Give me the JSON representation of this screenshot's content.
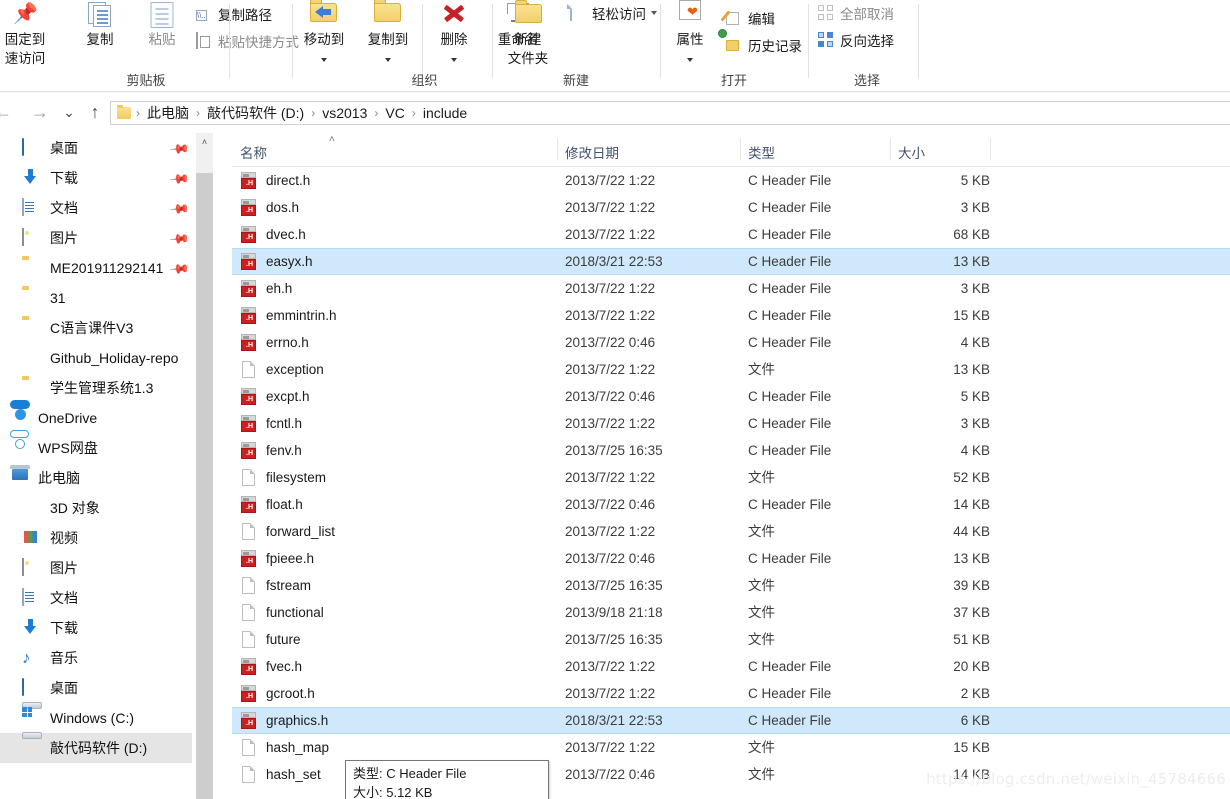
{
  "ribbon": {
    "groups": [
      {
        "name": "clipboard",
        "label": "剪贴板"
      },
      {
        "name": "organize",
        "label": "组织"
      },
      {
        "name": "new",
        "label": "新建"
      },
      {
        "name": "open",
        "label": "打开"
      },
      {
        "name": "select",
        "label": "选择"
      }
    ],
    "pin_to_quick_access": {
      "line1": "固定到",
      "line2": "速访问"
    },
    "copy": "复制",
    "paste": "粘贴",
    "copy_path": "复制路径",
    "paste_shortcut": "粘贴快捷方式",
    "move_to": "移动到",
    "copy_to": "复制到",
    "delete": "删除",
    "rename": "重命名",
    "new_folder": {
      "line1": "新建",
      "line2": "文件夹"
    },
    "easy_access": "轻松访问",
    "properties": "属性",
    "edit": "编辑",
    "history": "历史记录",
    "select_none": "全部取消",
    "invert_selection": "反向选择"
  },
  "nav": {
    "back_icon": "←",
    "forward_icon": "→",
    "recent_icon": "⌄",
    "up_icon": "↑",
    "breadcrumbs": [
      "此电脑",
      "敲代码软件 (D:)",
      "vs2013",
      "VC",
      "include"
    ],
    "separator": "›"
  },
  "sidebar": {
    "items": [
      {
        "label": "桌面",
        "icon": "desktop-icon",
        "indent": 1,
        "pinned": true
      },
      {
        "label": "下载",
        "icon": "download-icon",
        "indent": 1,
        "pinned": true
      },
      {
        "label": "文档",
        "icon": "documents-icon",
        "indent": 1,
        "pinned": true
      },
      {
        "label": "图片",
        "icon": "pictures-icon",
        "indent": 1,
        "pinned": true
      },
      {
        "label": "ME201911292141",
        "icon": "folder-icon",
        "indent": 1,
        "pinned": true
      },
      {
        "label": "31",
        "icon": "folder-icon",
        "indent": 1,
        "pinned": false
      },
      {
        "label": "C语言课件V3",
        "icon": "folder-icon",
        "indent": 1,
        "pinned": false
      },
      {
        "label": "Github_Holiday-repo",
        "icon": "git-folder-icon",
        "indent": 1,
        "pinned": false
      },
      {
        "label": "学生管理系统1.3",
        "icon": "folder-icon",
        "indent": 1,
        "pinned": false
      },
      {
        "label": "OneDrive",
        "icon": "onedrive-icon",
        "indent": 0,
        "pinned": false
      },
      {
        "label": "WPS网盘",
        "icon": "wps-cloud-icon",
        "indent": 0,
        "pinned": false
      },
      {
        "label": "此电脑",
        "icon": "this-pc-icon",
        "indent": 0,
        "pinned": false
      },
      {
        "label": "3D 对象",
        "icon": "3d-objects-icon",
        "indent": 1,
        "pinned": false
      },
      {
        "label": "视频",
        "icon": "videos-icon",
        "indent": 1,
        "pinned": false
      },
      {
        "label": "图片",
        "icon": "pictures-icon",
        "indent": 1,
        "pinned": false
      },
      {
        "label": "文档",
        "icon": "documents-icon",
        "indent": 1,
        "pinned": false
      },
      {
        "label": "下载",
        "icon": "download-icon",
        "indent": 1,
        "pinned": false
      },
      {
        "label": "音乐",
        "icon": "music-icon",
        "indent": 1,
        "pinned": false
      },
      {
        "label": "桌面",
        "icon": "desktop-icon",
        "indent": 1,
        "pinned": false
      },
      {
        "label": "Windows (C:)",
        "icon": "windows-drive-icon",
        "indent": 1,
        "pinned": false
      },
      {
        "label": "敲代码软件 (D:)",
        "icon": "drive-icon",
        "indent": 1,
        "pinned": false,
        "selected": true
      }
    ]
  },
  "filelist": {
    "columns": [
      "名称",
      "修改日期",
      "类型",
      "大小"
    ],
    "sort_indicator": "˄",
    "rows": [
      {
        "name": "direct.h",
        "date": "2013/7/22 1:22",
        "type": "C Header File",
        "size": "5 KB",
        "icon": "c-header-file-icon",
        "selected": false
      },
      {
        "name": "dos.h",
        "date": "2013/7/22 1:22",
        "type": "C Header File",
        "size": "3 KB",
        "icon": "c-header-file-icon",
        "selected": false
      },
      {
        "name": "dvec.h",
        "date": "2013/7/22 1:22",
        "type": "C Header File",
        "size": "68 KB",
        "icon": "c-header-file-icon",
        "selected": false
      },
      {
        "name": "easyx.h",
        "date": "2018/3/21 22:53",
        "type": "C Header File",
        "size": "13 KB",
        "icon": "c-header-file-icon",
        "selected": true
      },
      {
        "name": "eh.h",
        "date": "2013/7/22 1:22",
        "type": "C Header File",
        "size": "3 KB",
        "icon": "c-header-file-icon",
        "selected": false
      },
      {
        "name": "emmintrin.h",
        "date": "2013/7/22 1:22",
        "type": "C Header File",
        "size": "15 KB",
        "icon": "c-header-file-icon",
        "selected": false
      },
      {
        "name": "errno.h",
        "date": "2013/7/22 0:46",
        "type": "C Header File",
        "size": "4 KB",
        "icon": "c-header-file-icon",
        "selected": false
      },
      {
        "name": "exception",
        "date": "2013/7/22 1:22",
        "type": "文件",
        "size": "13 KB",
        "icon": "generic-file-icon",
        "selected": false
      },
      {
        "name": "excpt.h",
        "date": "2013/7/22 0:46",
        "type": "C Header File",
        "size": "5 KB",
        "icon": "c-header-file-icon",
        "selected": false
      },
      {
        "name": "fcntl.h",
        "date": "2013/7/22 1:22",
        "type": "C Header File",
        "size": "3 KB",
        "icon": "c-header-file-icon",
        "selected": false
      },
      {
        "name": "fenv.h",
        "date": "2013/7/25 16:35",
        "type": "C Header File",
        "size": "4 KB",
        "icon": "c-header-file-icon",
        "selected": false
      },
      {
        "name": "filesystem",
        "date": "2013/7/22 1:22",
        "type": "文件",
        "size": "52 KB",
        "icon": "generic-file-icon",
        "selected": false
      },
      {
        "name": "float.h",
        "date": "2013/7/22 0:46",
        "type": "C Header File",
        "size": "14 KB",
        "icon": "c-header-file-icon",
        "selected": false
      },
      {
        "name": "forward_list",
        "date": "2013/7/22 1:22",
        "type": "文件",
        "size": "44 KB",
        "icon": "generic-file-icon",
        "selected": false
      },
      {
        "name": "fpieee.h",
        "date": "2013/7/22 0:46",
        "type": "C Header File",
        "size": "13 KB",
        "icon": "c-header-file-icon",
        "selected": false
      },
      {
        "name": "fstream",
        "date": "2013/7/25 16:35",
        "type": "文件",
        "size": "39 KB",
        "icon": "generic-file-icon",
        "selected": false
      },
      {
        "name": "functional",
        "date": "2013/9/18 21:18",
        "type": "文件",
        "size": "37 KB",
        "icon": "generic-file-icon",
        "selected": false
      },
      {
        "name": "future",
        "date": "2013/7/25 16:35",
        "type": "文件",
        "size": "51 KB",
        "icon": "generic-file-icon",
        "selected": false
      },
      {
        "name": "fvec.h",
        "date": "2013/7/22 1:22",
        "type": "C Header File",
        "size": "20 KB",
        "icon": "c-header-file-icon",
        "selected": false
      },
      {
        "name": "gcroot.h",
        "date": "2013/7/22 1:22",
        "type": "C Header File",
        "size": "2 KB",
        "icon": "c-header-file-icon",
        "selected": false
      },
      {
        "name": "graphics.h",
        "date": "2018/3/21 22:53",
        "type": "C Header File",
        "size": "6 KB",
        "icon": "c-header-file-icon",
        "selected": true
      },
      {
        "name": "hash_map",
        "date": "2013/7/22 1:22",
        "type": "文件",
        "size": "15 KB",
        "icon": "generic-file-icon",
        "selected": false
      },
      {
        "name": "hash_set",
        "date": "2013/7/22 0:46",
        "type": "文件",
        "size": "14 KB",
        "icon": "generic-file-icon",
        "selected": false
      }
    ]
  },
  "tooltip": {
    "type_line": "类型: C Header File",
    "size_line": "大小: 5.12 KB"
  },
  "watermark": "https://blog.csdn.net/weixin_45784666"
}
